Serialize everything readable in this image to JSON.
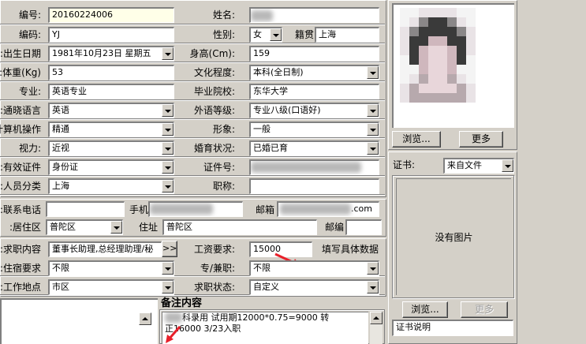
{
  "form": {
    "id_label": "编号:",
    "id_value": "20160224006",
    "code_label": "编码:",
    "code_value": "YJ",
    "birth_label": "出生日期:",
    "birth_value": "1981年10月23日 星期五",
    "weight_label": "体重(Kg):",
    "weight_value": "53",
    "major_label": "专业:",
    "major_value": "英语专业",
    "language_label": "通晓语言:",
    "language_value": "英语",
    "computer_label": "计算机操作:",
    "computer_value": "精通",
    "vision_label": "视力:",
    "vision_value": "近视",
    "idtype_label": "有效证件:",
    "idtype_value": "身份证",
    "category_label": "人员分类:",
    "category_value": "上海",
    "name_label": "姓名:",
    "name_value": "",
    "gender_label": "性别:",
    "gender_value": "女",
    "hometown_label": "籍贯",
    "hometown_value": "上海",
    "height_label": "身高(Cm):",
    "height_value": "159",
    "education_label": "文化程度:",
    "education_value": "本科(全日制)",
    "school_label": "毕业院校:",
    "school_value": "东华大学",
    "english_label": "外语等级:",
    "english_value": "专业八级(口语好)",
    "image_label": "形象:",
    "image_value": "一般",
    "marital_label": "婚育状况:",
    "marital_value": "已婚已育",
    "idnum_label": "证件号:",
    "idnum_value": "",
    "title_label": "职称:",
    "title_value": "",
    "phone_label": "联系电话:",
    "phone_value": "",
    "mobile_label": "手机",
    "mobile_value": "",
    "email_label": "邮箱",
    "email_value": ".com",
    "district_label": "居住区:",
    "district_value": "普陀区",
    "address_label": "住址",
    "address_value": "普陀区",
    "postcode_label": "邮编",
    "postcode_value": "",
    "job_label": "求职内容:",
    "job_value": "董事长助理,总经理助理/秘",
    "job_more": ">>",
    "salary_label": "工资要求:",
    "salary_value": "15000",
    "salary_note": "填写具体数据",
    "housing_label": "住宿要求:",
    "housing_value": "不限",
    "parttime_label": "专/兼职:",
    "parttime_value": "不限",
    "workplace_label": "工作地点:",
    "workplace_value": "市区",
    "status_label": "求职状态:",
    "status_value": "自定义"
  },
  "photo": {
    "browse": "浏览...",
    "more": "更多"
  },
  "cert": {
    "label": "证书:",
    "source": "来自文件",
    "empty": "没有图片",
    "browse": "浏览...",
    "more": "更多",
    "desc": "证书说明"
  },
  "notes": {
    "title": "备注内容",
    "line1": "科录用 试用期12000*0.75=9000 转",
    "line2": "正16000   3/23入职"
  },
  "colors": {
    "annotation_arrow": "#e8202a",
    "highlight_field": "#ffffe8"
  }
}
